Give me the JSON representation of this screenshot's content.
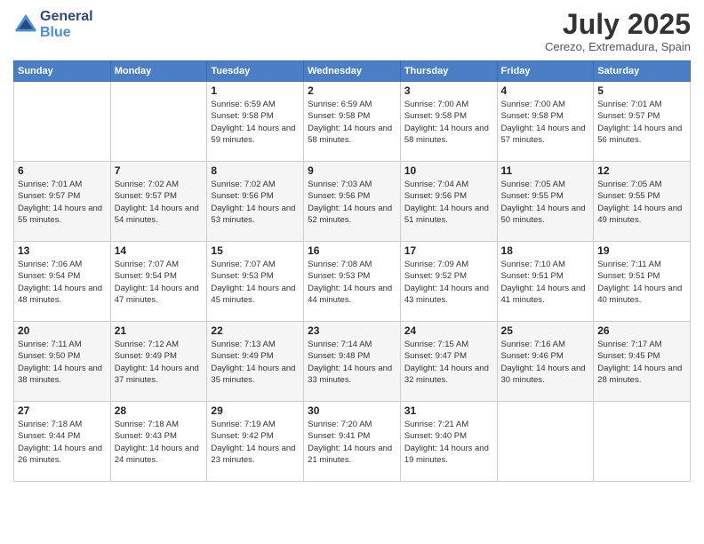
{
  "logo": {
    "text_general": "General",
    "text_blue": "Blue"
  },
  "header": {
    "month_year": "July 2025",
    "location": "Cerezo, Extremadura, Spain"
  },
  "days_of_week": [
    "Sunday",
    "Monday",
    "Tuesday",
    "Wednesday",
    "Thursday",
    "Friday",
    "Saturday"
  ],
  "weeks": [
    [
      {
        "num": "",
        "sunrise": "",
        "sunset": "",
        "daylight": ""
      },
      {
        "num": "",
        "sunrise": "",
        "sunset": "",
        "daylight": ""
      },
      {
        "num": "1",
        "sunrise": "Sunrise: 6:59 AM",
        "sunset": "Sunset: 9:58 PM",
        "daylight": "Daylight: 14 hours and 59 minutes."
      },
      {
        "num": "2",
        "sunrise": "Sunrise: 6:59 AM",
        "sunset": "Sunset: 9:58 PM",
        "daylight": "Daylight: 14 hours and 58 minutes."
      },
      {
        "num": "3",
        "sunrise": "Sunrise: 7:00 AM",
        "sunset": "Sunset: 9:58 PM",
        "daylight": "Daylight: 14 hours and 58 minutes."
      },
      {
        "num": "4",
        "sunrise": "Sunrise: 7:00 AM",
        "sunset": "Sunset: 9:58 PM",
        "daylight": "Daylight: 14 hours and 57 minutes."
      },
      {
        "num": "5",
        "sunrise": "Sunrise: 7:01 AM",
        "sunset": "Sunset: 9:57 PM",
        "daylight": "Daylight: 14 hours and 56 minutes."
      }
    ],
    [
      {
        "num": "6",
        "sunrise": "Sunrise: 7:01 AM",
        "sunset": "Sunset: 9:57 PM",
        "daylight": "Daylight: 14 hours and 55 minutes."
      },
      {
        "num": "7",
        "sunrise": "Sunrise: 7:02 AM",
        "sunset": "Sunset: 9:57 PM",
        "daylight": "Daylight: 14 hours and 54 minutes."
      },
      {
        "num": "8",
        "sunrise": "Sunrise: 7:02 AM",
        "sunset": "Sunset: 9:56 PM",
        "daylight": "Daylight: 14 hours and 53 minutes."
      },
      {
        "num": "9",
        "sunrise": "Sunrise: 7:03 AM",
        "sunset": "Sunset: 9:56 PM",
        "daylight": "Daylight: 14 hours and 52 minutes."
      },
      {
        "num": "10",
        "sunrise": "Sunrise: 7:04 AM",
        "sunset": "Sunset: 9:56 PM",
        "daylight": "Daylight: 14 hours and 51 minutes."
      },
      {
        "num": "11",
        "sunrise": "Sunrise: 7:05 AM",
        "sunset": "Sunset: 9:55 PM",
        "daylight": "Daylight: 14 hours and 50 minutes."
      },
      {
        "num": "12",
        "sunrise": "Sunrise: 7:05 AM",
        "sunset": "Sunset: 9:55 PM",
        "daylight": "Daylight: 14 hours and 49 minutes."
      }
    ],
    [
      {
        "num": "13",
        "sunrise": "Sunrise: 7:06 AM",
        "sunset": "Sunset: 9:54 PM",
        "daylight": "Daylight: 14 hours and 48 minutes."
      },
      {
        "num": "14",
        "sunrise": "Sunrise: 7:07 AM",
        "sunset": "Sunset: 9:54 PM",
        "daylight": "Daylight: 14 hours and 47 minutes."
      },
      {
        "num": "15",
        "sunrise": "Sunrise: 7:07 AM",
        "sunset": "Sunset: 9:53 PM",
        "daylight": "Daylight: 14 hours and 45 minutes."
      },
      {
        "num": "16",
        "sunrise": "Sunrise: 7:08 AM",
        "sunset": "Sunset: 9:53 PM",
        "daylight": "Daylight: 14 hours and 44 minutes."
      },
      {
        "num": "17",
        "sunrise": "Sunrise: 7:09 AM",
        "sunset": "Sunset: 9:52 PM",
        "daylight": "Daylight: 14 hours and 43 minutes."
      },
      {
        "num": "18",
        "sunrise": "Sunrise: 7:10 AM",
        "sunset": "Sunset: 9:51 PM",
        "daylight": "Daylight: 14 hours and 41 minutes."
      },
      {
        "num": "19",
        "sunrise": "Sunrise: 7:11 AM",
        "sunset": "Sunset: 9:51 PM",
        "daylight": "Daylight: 14 hours and 40 minutes."
      }
    ],
    [
      {
        "num": "20",
        "sunrise": "Sunrise: 7:11 AM",
        "sunset": "Sunset: 9:50 PM",
        "daylight": "Daylight: 14 hours and 38 minutes."
      },
      {
        "num": "21",
        "sunrise": "Sunrise: 7:12 AM",
        "sunset": "Sunset: 9:49 PM",
        "daylight": "Daylight: 14 hours and 37 minutes."
      },
      {
        "num": "22",
        "sunrise": "Sunrise: 7:13 AM",
        "sunset": "Sunset: 9:49 PM",
        "daylight": "Daylight: 14 hours and 35 minutes."
      },
      {
        "num": "23",
        "sunrise": "Sunrise: 7:14 AM",
        "sunset": "Sunset: 9:48 PM",
        "daylight": "Daylight: 14 hours and 33 minutes."
      },
      {
        "num": "24",
        "sunrise": "Sunrise: 7:15 AM",
        "sunset": "Sunset: 9:47 PM",
        "daylight": "Daylight: 14 hours and 32 minutes."
      },
      {
        "num": "25",
        "sunrise": "Sunrise: 7:16 AM",
        "sunset": "Sunset: 9:46 PM",
        "daylight": "Daylight: 14 hours and 30 minutes."
      },
      {
        "num": "26",
        "sunrise": "Sunrise: 7:17 AM",
        "sunset": "Sunset: 9:45 PM",
        "daylight": "Daylight: 14 hours and 28 minutes."
      }
    ],
    [
      {
        "num": "27",
        "sunrise": "Sunrise: 7:18 AM",
        "sunset": "Sunset: 9:44 PM",
        "daylight": "Daylight: 14 hours and 26 minutes."
      },
      {
        "num": "28",
        "sunrise": "Sunrise: 7:18 AM",
        "sunset": "Sunset: 9:43 PM",
        "daylight": "Daylight: 14 hours and 24 minutes."
      },
      {
        "num": "29",
        "sunrise": "Sunrise: 7:19 AM",
        "sunset": "Sunset: 9:42 PM",
        "daylight": "Daylight: 14 hours and 23 minutes."
      },
      {
        "num": "30",
        "sunrise": "Sunrise: 7:20 AM",
        "sunset": "Sunset: 9:41 PM",
        "daylight": "Daylight: 14 hours and 21 minutes."
      },
      {
        "num": "31",
        "sunrise": "Sunrise: 7:21 AM",
        "sunset": "Sunset: 9:40 PM",
        "daylight": "Daylight: 14 hours and 19 minutes."
      },
      {
        "num": "",
        "sunrise": "",
        "sunset": "",
        "daylight": ""
      },
      {
        "num": "",
        "sunrise": "",
        "sunset": "",
        "daylight": ""
      }
    ]
  ]
}
